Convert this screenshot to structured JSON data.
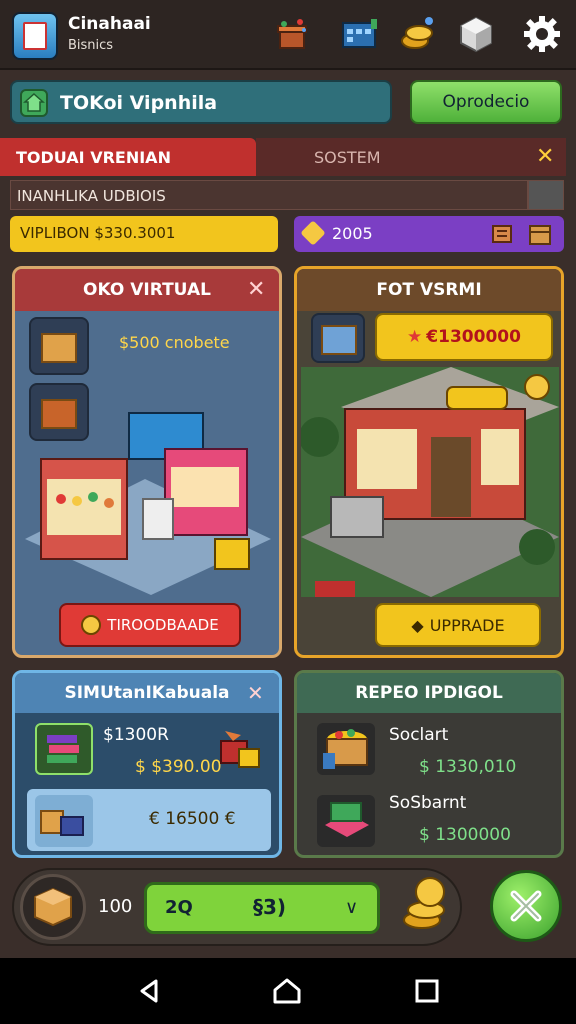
{
  "app": {
    "title": "Cinahaai",
    "subtitle": "Bisnics"
  },
  "top_icons": [
    {
      "name": "gift-icon"
    },
    {
      "name": "calendar-icon"
    },
    {
      "name": "coins-icon"
    },
    {
      "name": "cube-icon"
    },
    {
      "name": "gear-icon"
    }
  ],
  "search": {
    "value": "TOKoi Vipnhila"
  },
  "progress_button": {
    "label": "Oprodecio"
  },
  "tabs": [
    {
      "label": "TODUAI VRENIAN",
      "active": true
    },
    {
      "label": "SOSTEM",
      "active": false
    }
  ],
  "stats_line": {
    "text": "INANHLIKA UDBIOIS"
  },
  "money": {
    "label": "VIPLIBON $330.3001"
  },
  "gems": {
    "value": "2005"
  },
  "card_left": {
    "title": "OKO VIRTUAL",
    "price_text": "$500 cnobete",
    "upgrade_label": "TIROODBAADE"
  },
  "card_right": {
    "title": "FOT VSRMI",
    "offer_label": "€1300000",
    "upgrade_label": "UPPRADE"
  },
  "panel_left": {
    "title": "SIMUtanIKabuala",
    "items": [
      {
        "title": "$1300R",
        "price": "$ $390.00"
      },
      {
        "title": "",
        "price": "€ 16500 €"
      }
    ]
  },
  "panel_right": {
    "title": "REPEO IPDIGOL",
    "items": [
      {
        "title": "Soclart",
        "price": "$ 1330,010"
      },
      {
        "title": "SoSbarnt",
        "price": "$ 1300000"
      }
    ]
  },
  "bottom": {
    "stack_count": "100",
    "select_left": "2Q",
    "select_mid": "§3)",
    "select_caret": "∨"
  },
  "colors": {
    "accent_green": "#4fb13a",
    "accent_gold": "#f2c51d",
    "accent_red": "#c0302e",
    "accent_purple": "#7b3fc4"
  }
}
